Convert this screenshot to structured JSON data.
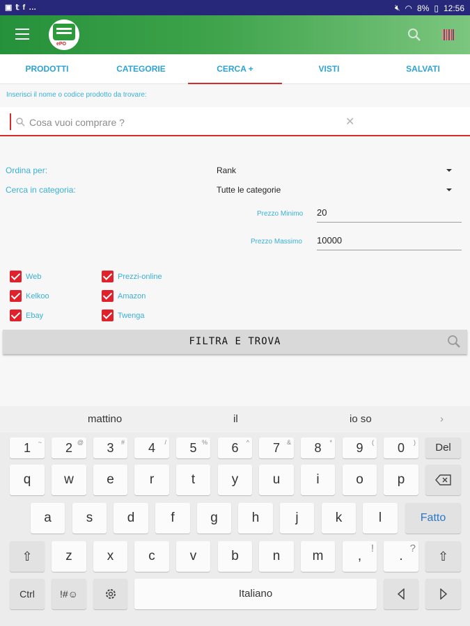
{
  "status": {
    "time": "12:56",
    "battery": "8%"
  },
  "tabs": [
    "PRODOTTI",
    "CATEGORIE",
    "CERCA +",
    "VISTI",
    "SALVATI"
  ],
  "active_tab": 2,
  "hint": "Inserisci il nome o codice prodotto da trovare:",
  "search": {
    "placeholder": "Cosa vuoi comprare ?"
  },
  "logo_text": "ePO",
  "filters": {
    "order_label": "Ordina per:",
    "order_value": "Rank",
    "category_label": "Cerca in categoria:",
    "category_value": "Tutte le categorie",
    "min_label": "Prezzo Minimo",
    "min_value": "20",
    "max_label": "Prezzo Massimo",
    "max_value": "10000"
  },
  "sources": [
    "Web",
    "Kelkoo",
    "Ebay",
    "Prezzi-online",
    "Amazon",
    "Twenga"
  ],
  "filter_button": "FILTRA E TROVA",
  "keyboard": {
    "suggestions": [
      "mattino",
      "il",
      "io so"
    ],
    "numrow": [
      [
        "1",
        "~"
      ],
      [
        "2",
        "@"
      ],
      [
        "3",
        "#"
      ],
      [
        "4",
        "/"
      ],
      [
        "5",
        "%"
      ],
      [
        "6",
        "^"
      ],
      [
        "7",
        "&"
      ],
      [
        "8",
        "*"
      ],
      [
        "9",
        "("
      ],
      [
        "0",
        ")"
      ]
    ],
    "del": "Del",
    "row1": [
      "q",
      "w",
      "e",
      "r",
      "t",
      "y",
      "u",
      "i",
      "o",
      "p"
    ],
    "row2": [
      "a",
      "s",
      "d",
      "f",
      "g",
      "h",
      "j",
      "k",
      "l"
    ],
    "done": "Fatto",
    "row3": [
      "z",
      "x",
      "c",
      "v",
      "b",
      "n",
      "m"
    ],
    "comma": ",",
    "comma_sup": "!",
    "period": ".",
    "period_sup": "?",
    "ctrl": "Ctrl",
    "symbols": "!#☺",
    "space": "Italiano"
  }
}
